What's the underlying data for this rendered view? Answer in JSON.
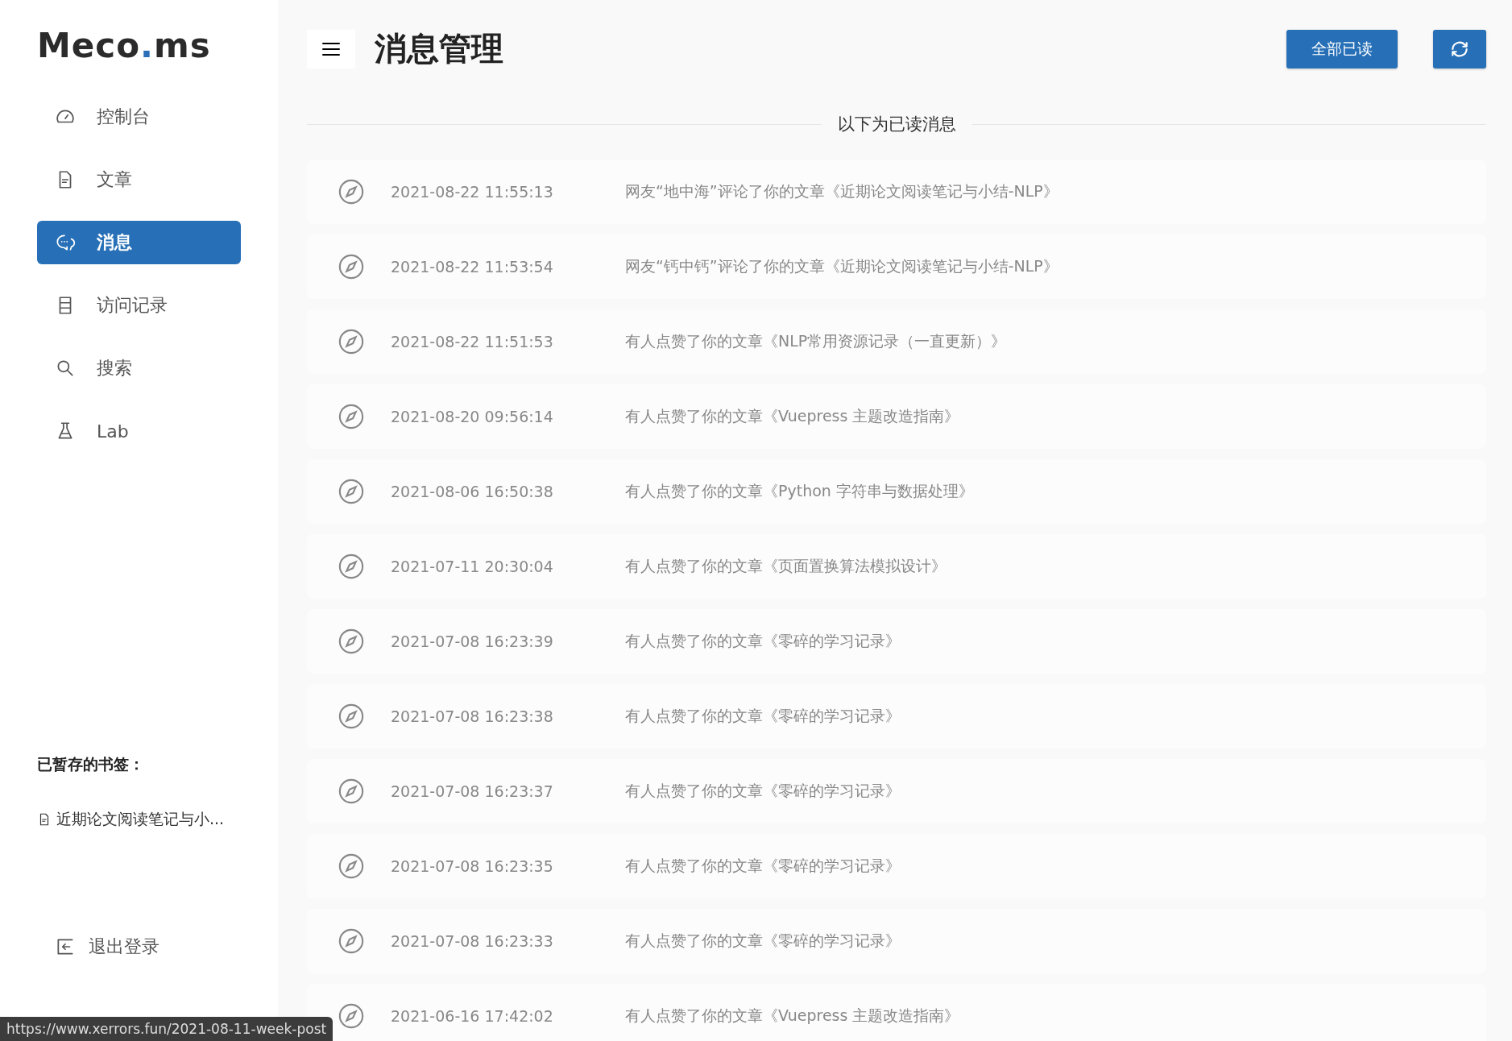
{
  "logo": {
    "name": "Meco",
    "dot": ".",
    "suffix": "ms"
  },
  "nav": [
    {
      "kind": "dashboard",
      "label": "控制台",
      "selected": false
    },
    {
      "kind": "article",
      "label": "文章",
      "selected": false
    },
    {
      "kind": "message",
      "label": "消息",
      "selected": true
    },
    {
      "kind": "records",
      "label": "访问记录",
      "selected": false
    },
    {
      "kind": "search",
      "label": "搜索",
      "selected": false
    },
    {
      "kind": "lab",
      "label": "Lab",
      "selected": false
    }
  ],
  "bookmarks": {
    "title": "已暂存的书签：",
    "items": [
      "近期论文阅读笔记与小..."
    ]
  },
  "logout": "退出登录",
  "header": {
    "title": "消息管理",
    "mark_all_read": "全部已读"
  },
  "divider": "以下为已读消息",
  "messages": [
    {
      "time": "2021-08-22 11:55:13",
      "text": "网友“地中海”评论了你的文章《近期论文阅读笔记与小结-NLP》"
    },
    {
      "time": "2021-08-22 11:53:54",
      "text": "网友“钙中钙”评论了你的文章《近期论文阅读笔记与小结-NLP》"
    },
    {
      "time": "2021-08-22 11:51:53",
      "text": "有人点赞了你的文章《NLP常用资源记录（一直更新）》"
    },
    {
      "time": "2021-08-20 09:56:14",
      "text": "有人点赞了你的文章《Vuepress 主题改造指南》"
    },
    {
      "time": "2021-08-06 16:50:38",
      "text": "有人点赞了你的文章《Python 字符串与数据处理》"
    },
    {
      "time": "2021-07-11 20:30:04",
      "text": "有人点赞了你的文章《页面置换算法模拟设计》"
    },
    {
      "time": "2021-07-08 16:23:39",
      "text": "有人点赞了你的文章《零碎的学习记录》"
    },
    {
      "time": "2021-07-08 16:23:38",
      "text": "有人点赞了你的文章《零碎的学习记录》"
    },
    {
      "time": "2021-07-08 16:23:37",
      "text": "有人点赞了你的文章《零碎的学习记录》"
    },
    {
      "time": "2021-07-08 16:23:35",
      "text": "有人点赞了你的文章《零碎的学习记录》"
    },
    {
      "time": "2021-07-08 16:23:33",
      "text": "有人点赞了你的文章《零碎的学习记录》"
    },
    {
      "time": "2021-06-16 17:42:02",
      "text": "有人点赞了你的文章《Vuepress 主题改造指南》"
    }
  ],
  "status_bar": "https://www.xerrors.fun/2021-08-11-week-post"
}
